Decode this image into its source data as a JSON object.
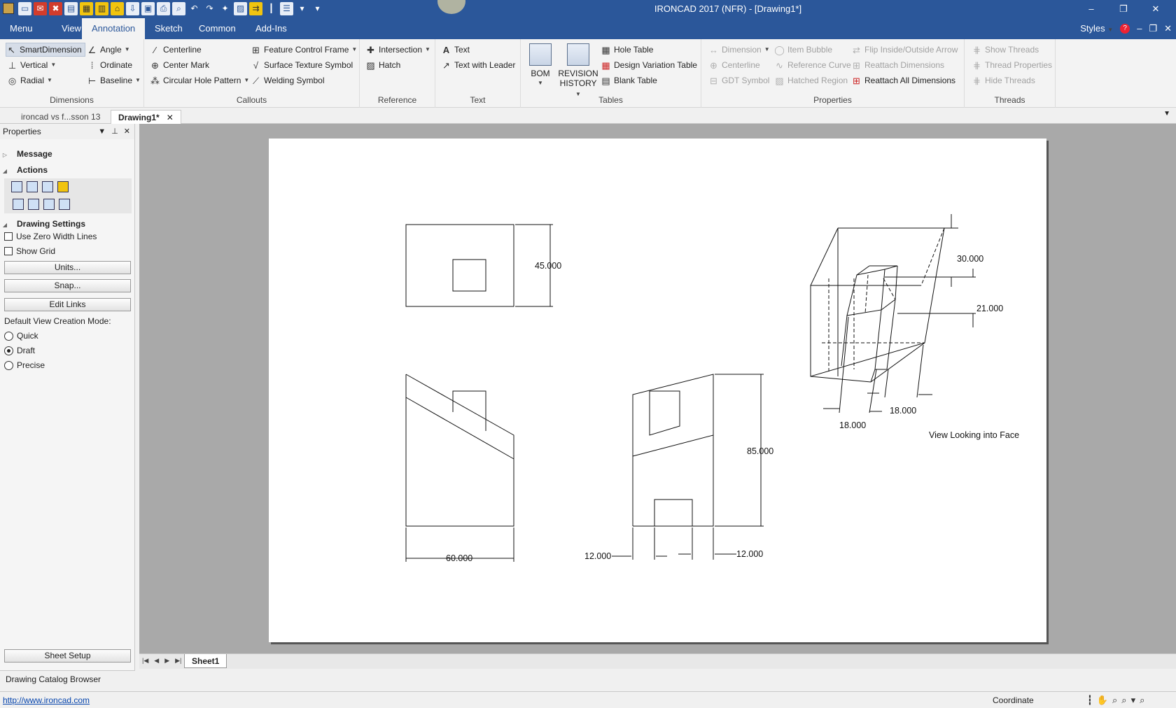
{
  "window": {
    "title": "IRONCAD 2017 (NFR) - [Drawing1*]",
    "controls": [
      "–",
      "❐",
      "✕"
    ]
  },
  "ribbon_tabs": [
    "Menu",
    "View",
    "Annotation",
    "Sketch",
    "Common",
    "Add-Ins"
  ],
  "active_tab": "Annotation",
  "styles_label": "Styles",
  "doc_controls": [
    "–",
    "❐",
    "✕"
  ],
  "ribbon": {
    "dimensions": {
      "label": "Dimensions",
      "items": [
        "SmartDimension",
        "Angle",
        "Vertical",
        "Ordinate",
        "Radial",
        "Baseline"
      ]
    },
    "callouts": {
      "label": "Callouts",
      "items": [
        "Centerline",
        "Feature Control Frame",
        "Center Mark",
        "Surface Texture Symbol",
        "Circular Hole Pattern",
        "Welding Symbol"
      ]
    },
    "reference": {
      "label": "Reference",
      "items": [
        "Intersection",
        "Hatch"
      ]
    },
    "text": {
      "label": "Text",
      "items": [
        "Text",
        "Text with Leader"
      ]
    },
    "tables": {
      "label": "Tables",
      "bom": "BOM",
      "revision_line1": "REVISION",
      "revision_line2": "HISTORY",
      "items": [
        "Hole Table",
        "Design Variation Table",
        "Blank Table"
      ]
    },
    "properties": {
      "label": "Properties",
      "items": [
        "Dimension",
        "Item Bubble",
        "Flip Inside/Outside Arrow",
        "Centerline",
        "Reference Curve",
        "Reattach Dimensions",
        "GDT Symbol",
        "Hatched Region",
        "Reattach All Dimensions"
      ]
    },
    "threads": {
      "label": "Threads",
      "items": [
        "Show Threads",
        "Thread Properties",
        "Hide Threads"
      ]
    }
  },
  "doc_tabs": [
    "ironcad vs f...sson 13",
    "Drawing1*"
  ],
  "properties_panel": {
    "title": "Properties",
    "message": "Message",
    "actions": "Actions",
    "drawing_settings": "Drawing Settings",
    "use_zero_width_lines": "Use Zero Width Lines",
    "show_grid": "Show Grid",
    "units_button": "Units...",
    "snap_button": "Snap...",
    "edit_links_button": "Edit Links",
    "view_mode_label": "Default View Creation Mode:",
    "modes": [
      "Quick",
      "Draft",
      "Precise"
    ],
    "selected_mode": "Draft",
    "sheet_setup": "Sheet Setup"
  },
  "catalog_browser": "Drawing Catalog Browser",
  "drawing": {
    "dims": {
      "top_height": "45.000",
      "bottom_width": "60.000",
      "side_height": "85.000",
      "left_offset": "12.000",
      "right_offset": "12.000",
      "iso_top": "30.000",
      "iso_mid": "21.000",
      "iso_w1": "18.000",
      "iso_w2": "18.000"
    },
    "view_label": "View Looking into Face"
  },
  "sheet_tab": "Sheet1",
  "status": {
    "url": "http://www.ironcad.com",
    "coordinate": "Coordinate"
  }
}
